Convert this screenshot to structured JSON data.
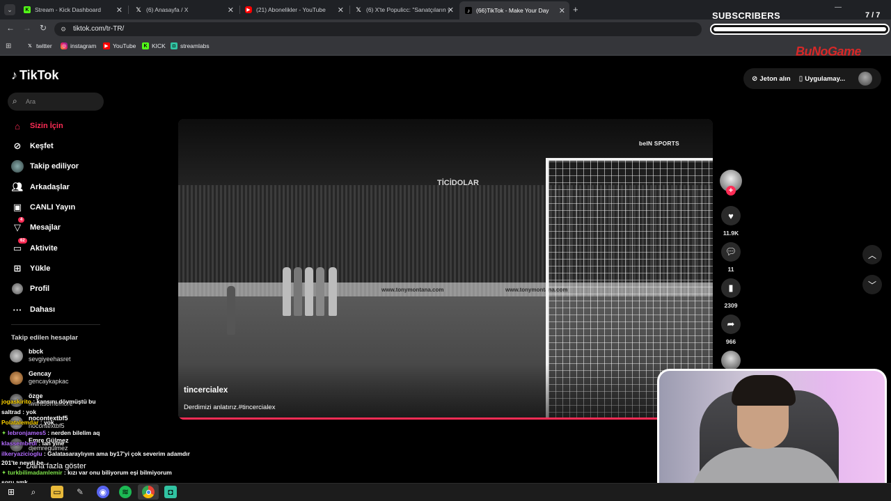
{
  "browser": {
    "tabs": [
      {
        "title": "Stream - Kick Dashboard",
        "icon": "kick-icon"
      },
      {
        "title": "(6) Anasayfa / X",
        "icon": "x-icon"
      },
      {
        "title": "(21) Abonelikler - YouTube",
        "icon": "youtube-icon"
      },
      {
        "title": "(6) X'te Populicc: \"Sanatçıların y",
        "icon": "x-icon"
      },
      {
        "title": "(66)TikTok - Make Your Day",
        "icon": "tiktok-icon",
        "active": true
      }
    ],
    "new_tab": "+",
    "url": "tiktok.com/tr-TR/",
    "bookmarks": [
      {
        "label": "twitter",
        "icon": "x-icon"
      },
      {
        "label": "instagram",
        "icon": "instagram-icon"
      },
      {
        "label": "YouTube",
        "icon": "youtube-icon"
      },
      {
        "label": "KICK",
        "icon": "kick-icon"
      },
      {
        "label": "streamlabs",
        "icon": "streamlabs-icon"
      }
    ]
  },
  "overlay": {
    "subscribers_title": "SUBSCRIBERS",
    "subscribers_count": "7 / 7",
    "subscribers_progress": 1.0,
    "brand": "BuNoGame"
  },
  "tiktok": {
    "logo": "TikTok",
    "search_placeholder": "Ara",
    "nav": [
      {
        "label": "Sizin İçin",
        "icon": "home-icon",
        "active": true
      },
      {
        "label": "Keşfet",
        "icon": "compass-icon"
      },
      {
        "label": "Takip ediliyor",
        "icon": "following-avatar-icon"
      },
      {
        "label": "Arkadaşlar",
        "icon": "friends-icon"
      },
      {
        "label": "CANLI Yayın",
        "icon": "live-icon"
      },
      {
        "label": "Mesajlar",
        "icon": "messages-icon",
        "badge": "4"
      },
      {
        "label": "Aktivite",
        "icon": "activity-icon",
        "badge": "62"
      },
      {
        "label": "Yükle",
        "icon": "upload-icon"
      },
      {
        "label": "Profil",
        "icon": "profile-avatar-icon"
      },
      {
        "label": "Dahası",
        "icon": "more-dots-icon"
      }
    ],
    "following_title": "Takip edilen hesaplar",
    "following": [
      {
        "name": "bbck",
        "handle": "sevgiyeehasret"
      },
      {
        "name": "Gencay",
        "handle": "gencaykapkac"
      },
      {
        "name": "özge",
        "handle": "iwantsomemore"
      },
      {
        "name": "nocontextbf5",
        "handle": "nocontextbf5"
      },
      {
        "name": "Emre Gülmez",
        "handle": "djemregulmez"
      }
    ],
    "show_more": "Daha fazla göster",
    "top_actions": {
      "coins": "Jeton alın",
      "app": "Uygulamay..."
    },
    "video": {
      "author": "tincercialex",
      "caption": "Derdimizi anlatırız.#tincercialex",
      "watermark": "beIN SPORTS",
      "ad_texts": [
        "TİCİDOLAR",
        "www.tonymontana.com",
        "www.tonymontana.com"
      ],
      "progress": 1.0
    },
    "rail": {
      "likes": "11.9K",
      "comments": "11",
      "saves": "2309",
      "shares": "966"
    }
  },
  "chat": [
    {
      "user": "jogaskirito",
      "text": " : kansını dövmüştü bu",
      "color": "#ffd400"
    },
    {
      "user": "saltrad",
      "text": " : yok",
      "color": "#ffffff"
    },
    {
      "user": "Polatalemdar",
      "text": " : yok",
      "color": "#ffd400"
    },
    {
      "user": "lebronjames5",
      "text": " : nerden bilelim aq",
      "color": "#b36bff"
    },
    {
      "user": "klassembedi",
      "text": " : lan yine",
      "color": "#b36bff"
    },
    {
      "user": "ilkeryazicioglu",
      "text": " : Galatasaraylıyım ama by17'yi çok severim adamdır",
      "color": "#b36bff"
    },
    {
      "user": "",
      "text": "201'te neydi be...",
      "color": "#ffffff"
    },
    {
      "user": "turkbilimadamlemir",
      "text": " : kızı var onu biliyorum eşi bilmiyorum",
      "color": "#7ee24a"
    },
    {
      "user": "",
      "text": "soru amk",
      "color": "#ffffff"
    }
  ]
}
